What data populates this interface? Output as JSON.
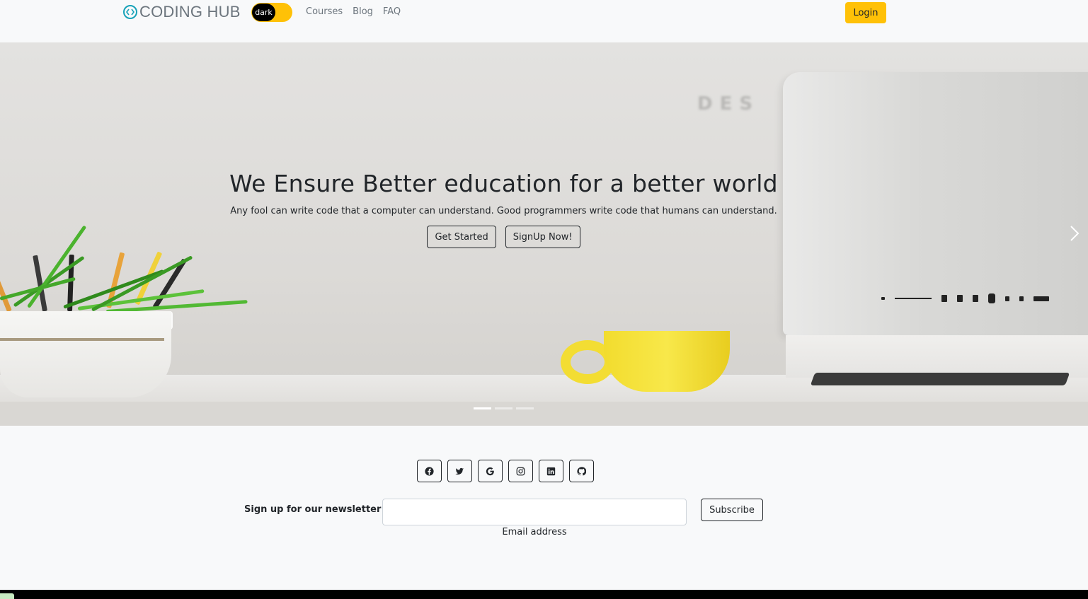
{
  "navbar": {
    "brand": "CODING HUB",
    "theme_toggle_label": "dark",
    "links": [
      "Courses",
      "Blog",
      "FAQ"
    ],
    "login_label": "Login"
  },
  "hero": {
    "wall_text": "DES",
    "title": "We Ensure Better education for a better world",
    "subtitle": "Any fool can write code that a computer can understand. Good programmers write code that humans can understand.",
    "primary_button": "Get Started",
    "secondary_button": "SignUp Now!",
    "slide_count": 3,
    "active_slide": 1
  },
  "footer": {
    "social_icons": [
      "facebook-icon",
      "twitter-icon",
      "google-icon",
      "instagram-icon",
      "linkedin-icon",
      "github-icon"
    ],
    "newsletter_label": "Sign up for our newsletter",
    "email_placeholder": "",
    "email_help": "Email address",
    "subscribe_label": "Subscribe"
  },
  "colors": {
    "accent": "#ffc107",
    "text": "#212529",
    "muted": "#6c757d",
    "background": "#f8f9fa"
  }
}
